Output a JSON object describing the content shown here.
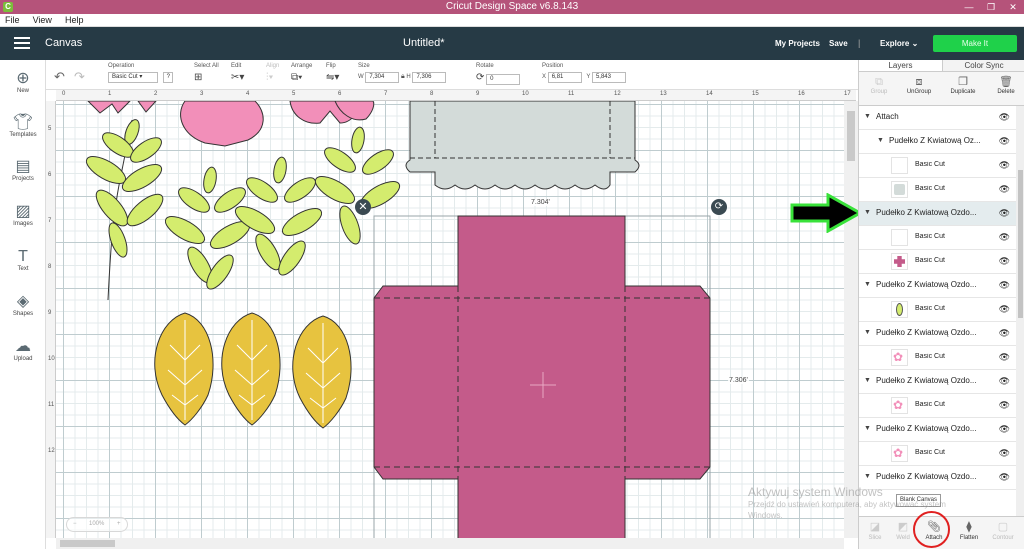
{
  "window": {
    "app_icon": "C",
    "title": "Cricut Design Space  v6.8.143",
    "minimize": "—",
    "maximize": "❐",
    "close": "✕"
  },
  "menu": [
    "File",
    "View",
    "Help"
  ],
  "header": {
    "canvas_label": "Canvas",
    "doc_title": "Untitled*",
    "my_projects": "My Projects",
    "save": "Save",
    "separator": "|",
    "explore": "Explore",
    "make_it": "Make It"
  },
  "toolbar": {
    "operation_label": "Operation",
    "operation_value": "Basic Cut",
    "select_all_label": "Select All",
    "edit_label": "Edit",
    "align_label": "Align",
    "arrange_label": "Arrange",
    "flip_label": "Flip",
    "size_label": "Size",
    "size_w_label": "W",
    "size_w": "7,304",
    "size_h_label": "H",
    "size_h": "7,306",
    "rotate_label": "Rotate",
    "rotate_value": "0",
    "position_label": "Position",
    "pos_x_label": "X",
    "pos_x": "6,81",
    "pos_y_label": "Y",
    "pos_y": "5,843"
  },
  "leftnav": [
    {
      "label": "New",
      "icon": "new-icon"
    },
    {
      "label": "Templates",
      "icon": "templates-icon"
    },
    {
      "label": "Projects",
      "icon": "projects-icon"
    },
    {
      "label": "Images",
      "icon": "images-icon"
    },
    {
      "label": "Text",
      "icon": "text-icon"
    },
    {
      "label": "Shapes",
      "icon": "shapes-icon"
    },
    {
      "label": "Upload",
      "icon": "upload-icon"
    }
  ],
  "ruler": {
    "top": [
      "0",
      "1",
      "2",
      "3",
      "4",
      "5",
      "6",
      "7",
      "8",
      "9",
      "10",
      "11",
      "12",
      "13",
      "14",
      "15",
      "16",
      "17"
    ],
    "left": [
      "5",
      "6",
      "7",
      "8",
      "9",
      "10",
      "11",
      "12"
    ]
  },
  "canvas": {
    "width_dim": "7.304'",
    "height_dim": "7.306'",
    "zoom": "100%",
    "zoom_minus": "−",
    "zoom_plus": "+",
    "colors": {
      "pink_box": "#c45b8a",
      "leaf_green": "#d4ec6e",
      "leaf_gold": "#e7c33f",
      "flower_pink": "#f28fb9",
      "grey_box": "#d3dbd9"
    }
  },
  "panel": {
    "tabs": [
      "Layers",
      "Color Sync"
    ],
    "actions": [
      "Group",
      "UnGroup",
      "Duplicate",
      "Delete"
    ],
    "layers": [
      {
        "name": "Attach",
        "level": 0
      },
      {
        "name": "Pudełko Z Kwiatową Oz...",
        "level": 1
      },
      {
        "name": "Basic Cut",
        "level": 2,
        "thumb": "blank"
      },
      {
        "name": "Basic Cut",
        "level": 2,
        "thumb": "grey"
      },
      {
        "name": "Pudełko Z Kwiatową Ozdo...",
        "level": 0,
        "selected": true
      },
      {
        "name": "Basic Cut",
        "level": 2,
        "thumb": "blank"
      },
      {
        "name": "Basic Cut",
        "level": 2,
        "thumb": "pink-box"
      },
      {
        "name": "Pudełko Z Kwiatową Ozdo...",
        "level": 0
      },
      {
        "name": "Basic Cut",
        "level": 2,
        "thumb": "leaf"
      },
      {
        "name": "Pudełko Z Kwiatową Ozdo...",
        "level": 0
      },
      {
        "name": "Basic Cut",
        "level": 2,
        "thumb": "flower"
      },
      {
        "name": "Pudełko Z Kwiatową Ozdo...",
        "level": 0
      },
      {
        "name": "Basic Cut",
        "level": 2,
        "thumb": "flower"
      },
      {
        "name": "Pudełko Z Kwiatową Ozdo...",
        "level": 0
      },
      {
        "name": "Basic Cut",
        "level": 2,
        "thumb": "flower"
      },
      {
        "name": "Pudełko Z Kwiatową Ozdo...",
        "level": 0
      }
    ],
    "bottom_actions": [
      "Slice",
      "Weld",
      "Attach",
      "Flatten",
      "Contour"
    ],
    "tooltip": "Blank Canvas"
  },
  "watermark": {
    "line1": "Aktywuj system Windows",
    "line2": "Przejdź do ustawień komputera, aby aktywować system",
    "line3": "Windows."
  }
}
